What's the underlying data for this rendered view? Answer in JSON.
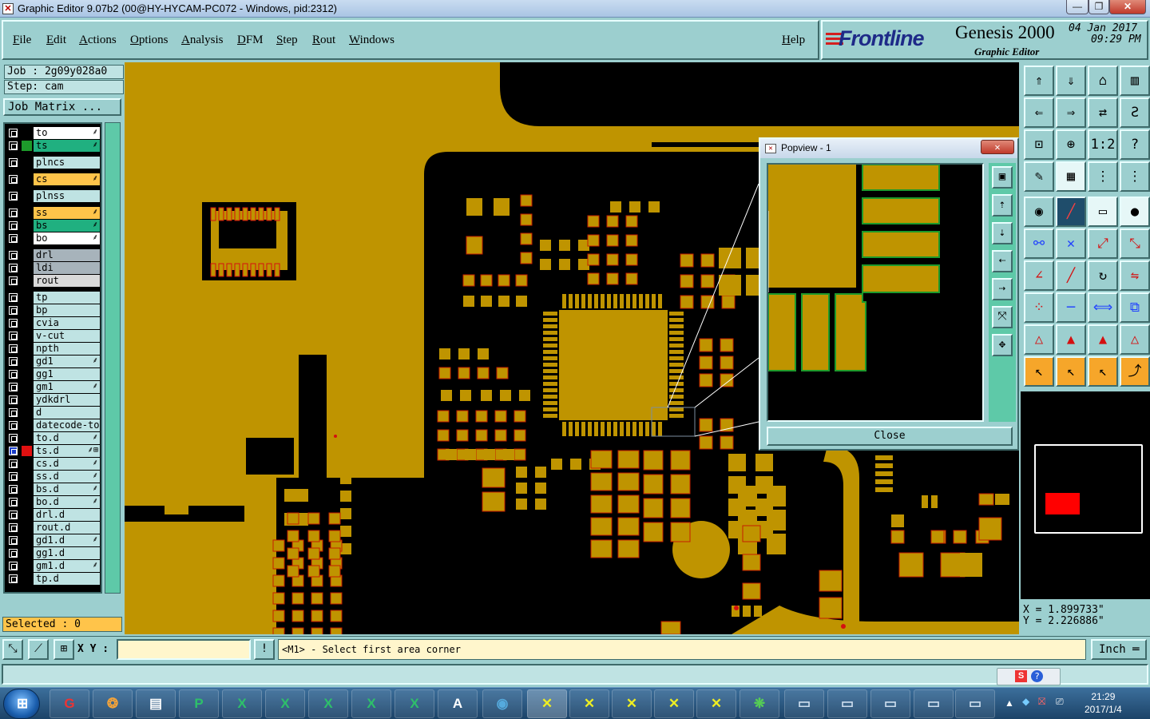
{
  "window": {
    "title": "Graphic Editor 9.07b2 (00@HY-HYCAM-PC072 - Windows, pid:2312)",
    "controls": [
      "—",
      "❐",
      "✕"
    ]
  },
  "menu": {
    "items": [
      "File",
      "Edit",
      "Actions",
      "Options",
      "Analysis",
      "DFM",
      "Step",
      "Rout",
      "Windows"
    ],
    "help": "Help"
  },
  "brand": {
    "logo": "Frontline",
    "product": "Genesis 2000",
    "subtitle": "Graphic Editor",
    "date": "04 Jan 2017",
    "time": "09:29 PM"
  },
  "job": {
    "job_label": "Job : 2g09y028a0",
    "step_label": "Step: cam",
    "matrix_button": "Job Matrix ..."
  },
  "layers": [
    {
      "name": "to",
      "color": "#ffffff",
      "swatch": "",
      "mark": "⸙"
    },
    {
      "name": "ts",
      "color": "#20b080",
      "swatch": "#1d9a2b",
      "mark": "⸙"
    },
    {
      "name": "plncs",
      "color": "#bfe3e3",
      "swatch": "",
      "mark": ""
    },
    {
      "name": "cs",
      "color": "#ffc44a",
      "swatch": "",
      "mark": "⸙"
    },
    {
      "name": "plnss",
      "color": "#bfe3e3",
      "swatch": "",
      "mark": ""
    },
    {
      "name": "ss",
      "color": "#ffc44a",
      "swatch": "",
      "mark": "⸙"
    },
    {
      "name": "bs",
      "color": "#20b080",
      "swatch": "",
      "mark": "⸙"
    },
    {
      "name": "bo",
      "color": "#ffffff",
      "swatch": "",
      "mark": "⸙"
    },
    {
      "name": "drl",
      "color": "#a7b3bb",
      "swatch": "",
      "mark": ""
    },
    {
      "name": "ldi",
      "color": "#a7b3bb",
      "swatch": "",
      "mark": ""
    },
    {
      "name": "rout",
      "color": "#d9d9d9",
      "swatch": "",
      "mark": ""
    },
    {
      "name": "tp",
      "color": "#bfe3e3",
      "swatch": "",
      "mark": ""
    },
    {
      "name": "bp",
      "color": "#bfe3e3",
      "swatch": "",
      "mark": ""
    },
    {
      "name": "cvia",
      "color": "#bfe3e3",
      "swatch": "",
      "mark": ""
    },
    {
      "name": "v-cut",
      "color": "#bfe3e3",
      "swatch": "",
      "mark": ""
    },
    {
      "name": "npth",
      "color": "#bfe3e3",
      "swatch": "",
      "mark": ""
    },
    {
      "name": "gd1",
      "color": "#bfe3e3",
      "swatch": "",
      "mark": "⸙"
    },
    {
      "name": "gg1",
      "color": "#bfe3e3",
      "swatch": "",
      "mark": ""
    },
    {
      "name": "gm1",
      "color": "#bfe3e3",
      "swatch": "",
      "mark": "⸙"
    },
    {
      "name": "ydkdrl",
      "color": "#bfe3e3",
      "swatch": "",
      "mark": ""
    },
    {
      "name": "d",
      "color": "#bfe3e3",
      "swatch": "",
      "mark": ""
    },
    {
      "name": "datecode-to",
      "color": "#bfe3e3",
      "swatch": "",
      "mark": ""
    },
    {
      "name": "to.d",
      "color": "#bfe3e3",
      "swatch": "",
      "mark": "⸙"
    },
    {
      "name": "ts.d",
      "color": "#bfe3e3",
      "swatch": "#e01010",
      "mark": "⸙⊞",
      "active": true
    },
    {
      "name": "cs.d",
      "color": "#bfe3e3",
      "swatch": "",
      "mark": "⸙"
    },
    {
      "name": "ss.d",
      "color": "#bfe3e3",
      "swatch": "",
      "mark": "⸙"
    },
    {
      "name": "bs.d",
      "color": "#bfe3e3",
      "swatch": "",
      "mark": "⸙"
    },
    {
      "name": "bo.d",
      "color": "#bfe3e3",
      "swatch": "",
      "mark": "⸙"
    },
    {
      "name": "drl.d",
      "color": "#bfe3e3",
      "swatch": "",
      "mark": ""
    },
    {
      "name": "rout.d",
      "color": "#bfe3e3",
      "swatch": "",
      "mark": ""
    },
    {
      "name": "gd1.d",
      "color": "#bfe3e3",
      "swatch": "",
      "mark": "⸙"
    },
    {
      "name": "gg1.d",
      "color": "#bfe3e3",
      "swatch": "",
      "mark": ""
    },
    {
      "name": "gm1.d",
      "color": "#bfe3e3",
      "swatch": "",
      "mark": "⸙"
    },
    {
      "name": "tp.d",
      "color": "#bfe3e3",
      "swatch": "",
      "mark": ""
    }
  ],
  "selected": "Selected : 0",
  "popview": {
    "title": "Popview - 1",
    "close_button": "Close"
  },
  "coords": {
    "x": "X = 1.899733\"",
    "y": "Y = 2.226886\""
  },
  "status": {
    "xy_label": "X Y :",
    "xy_value": "",
    "prompt": "<M1> - Select first area corner",
    "units": "Inch ═"
  },
  "taskbar": {
    "time": "21:29",
    "date": "2017/1/4"
  },
  "colors": {
    "copper": "#bf9400",
    "board_bg": "#000000",
    "panel": "#9ccfcf"
  }
}
